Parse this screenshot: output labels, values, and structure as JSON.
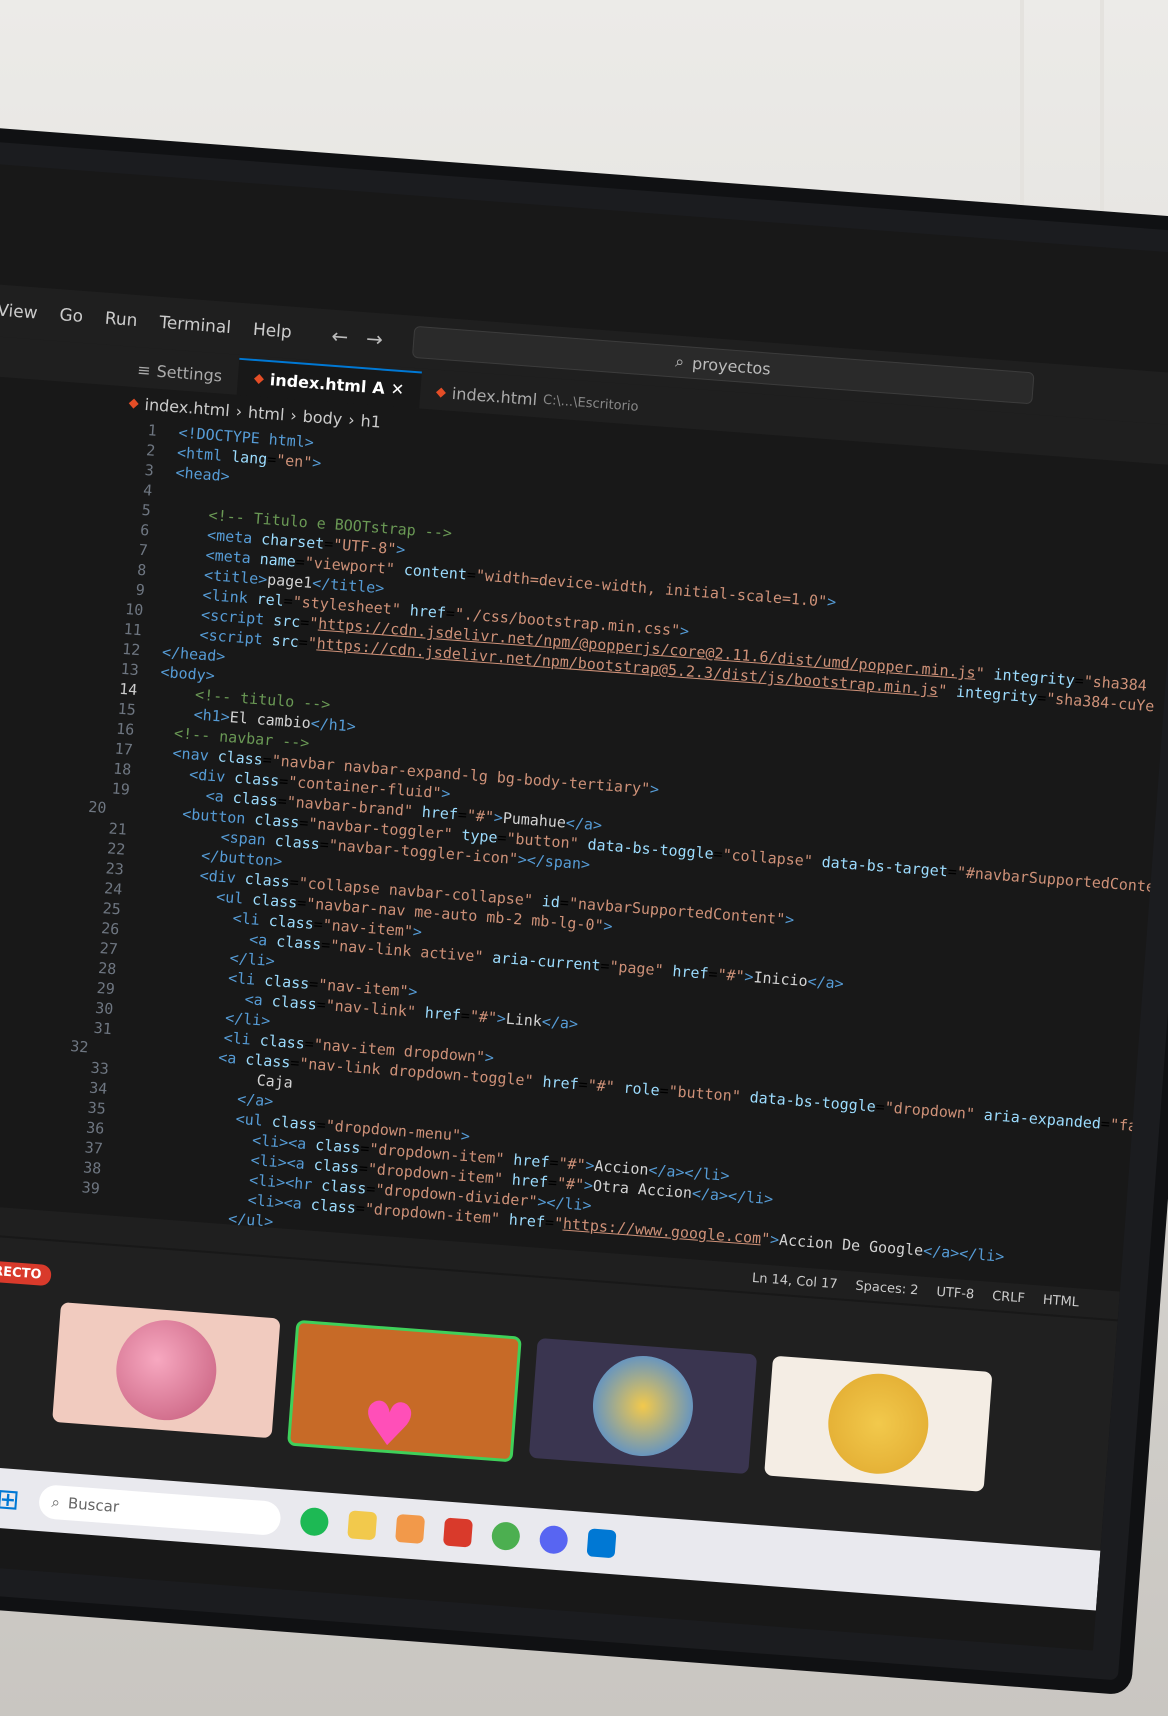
{
  "menu": [
    "View",
    "Go",
    "Run",
    "Terminal",
    "Help"
  ],
  "search": {
    "label": "proyectos"
  },
  "tabs": [
    {
      "label": "Settings"
    },
    {
      "label": "index.html",
      "active": true,
      "modified": "A"
    },
    {
      "label": "index.html",
      "path": "C:\\...\\Escritorio"
    }
  ],
  "breadcrumb": [
    "index.html",
    "html",
    "body",
    "h1"
  ],
  "code": [
    {
      "n": "1",
      "html": "<span class='tag'>&lt;!DOCTYPE html&gt;</span>"
    },
    {
      "n": "2",
      "html": "<span class='tag'>&lt;html</span> <span class='attr'>lang</span>=<span class='str'>\"en\"</span><span class='tag'>&gt;</span>"
    },
    {
      "n": "3",
      "html": "<span class='tag'>&lt;head&gt;</span>"
    },
    {
      "n": "4",
      "html": ""
    },
    {
      "n": "5",
      "html": "    <span class='cmt'>&lt;!-- Titulo e BOOTstrap --&gt;</span>"
    },
    {
      "n": "6",
      "html": "    <span class='tag'>&lt;meta</span> <span class='attr'>charset</span>=<span class='str'>\"UTF-8\"</span><span class='tag'>&gt;</span>"
    },
    {
      "n": "7",
      "html": "    <span class='tag'>&lt;meta</span> <span class='attr'>name</span>=<span class='str'>\"viewport\"</span> <span class='attr'>content</span>=<span class='str'>\"width=device-width, initial-scale=1.0\"</span><span class='tag'>&gt;</span>"
    },
    {
      "n": "8",
      "html": "    <span class='tag'>&lt;title&gt;</span><span class='txt'>page1</span><span class='tag'>&lt;/title&gt;</span>"
    },
    {
      "n": "9",
      "html": "    <span class='tag'>&lt;link</span> <span class='attr'>rel</span>=<span class='str'>\"stylesheet\"</span> <span class='attr'>href</span>=<span class='str'>\"./css/bootstrap.min.css\"</span><span class='tag'>&gt;</span>"
    },
    {
      "n": "10",
      "html": "    <span class='tag'>&lt;script</span> <span class='attr'>src</span>=<span class='str'>\"<span class='url'>https://cdn.jsdelivr.net/npm/@popperjs/core@2.11.6/dist/umd/popper.min.js</span>\"</span> <span class='attr'>integrity</span>=<span class='str'>\"sha384</span>"
    },
    {
      "n": "11",
      "html": "    <span class='tag'>&lt;script</span> <span class='attr'>src</span>=<span class='str'>\"<span class='url'>https://cdn.jsdelivr.net/npm/bootstrap@5.2.3/dist/js/bootstrap.min.js</span>\"</span> <span class='attr'>integrity</span>=<span class='str'>\"sha384-cuYe</span>"
    },
    {
      "n": "12",
      "html": "<span class='tag'>&lt;/head&gt;</span>"
    },
    {
      "n": "13",
      "html": "<span class='tag'>&lt;body&gt;</span>"
    },
    {
      "n": "14",
      "html": "    <span class='cmt'>&lt;!-- titulo --&gt;</span>",
      "cur": true
    },
    {
      "n": "15",
      "html": "    <span class='tag'>&lt;h1&gt;</span><span class='txt'>El cambio</span><span class='tag'>&lt;/h1&gt;</span>"
    },
    {
      "n": "16",
      "html": "  <span class='cmt'>&lt;!-- navbar --&gt;</span>"
    },
    {
      "n": "17",
      "html": "  <span class='tag'>&lt;nav</span> <span class='attr'>class</span>=<span class='str'>\"navbar navbar-expand-lg bg-body-tertiary\"</span><span class='tag'>&gt;</span>"
    },
    {
      "n": "18",
      "html": "    <span class='tag'>&lt;div</span> <span class='attr'>class</span>=<span class='str'>\"container-fluid\"</span><span class='tag'>&gt;</span>"
    },
    {
      "n": "19",
      "html": "      <span class='tag'>&lt;a</span> <span class='attr'>class</span>=<span class='str'>\"navbar-brand\"</span> <span class='attr'>href</span>=<span class='str'>\"#\"</span><span class='tag'>&gt;</span><span class='txt'>Pumahue</span><span class='tag'>&lt;/a&gt;</span>"
    },
    {
      "n": "20",
      "html": "      <span class='tag'>&lt;button</span> <span class='attr'>class</span>=<span class='str'>\"navbar-toggler\"</span> <span class='attr'>type</span>=<span class='str'>\"button\"</span> <span class='attr'>data-bs-toggle</span>=<span class='str'>\"collapse\"</span> <span class='attr'>data-bs-target</span>=<span class='str'>\"#navbarSupportedConte</span>"
    },
    {
      "n": "21",
      "html": "        <span class='tag'>&lt;span</span> <span class='attr'>class</span>=<span class='str'>\"navbar-toggler-icon\"</span><span class='tag'>&gt;&lt;/span&gt;</span>"
    },
    {
      "n": "22",
      "html": "      <span class='tag'>&lt;/button&gt;</span>"
    },
    {
      "n": "23",
      "html": "      <span class='tag'>&lt;div</span> <span class='attr'>class</span>=<span class='str'>\"collapse navbar-collapse\"</span> <span class='attr'>id</span>=<span class='str'>\"navbarSupportedContent\"</span><span class='tag'>&gt;</span>"
    },
    {
      "n": "24",
      "html": "        <span class='tag'>&lt;ul</span> <span class='attr'>class</span>=<span class='str'>\"navbar-nav me-auto mb-2 mb-lg-0\"</span><span class='tag'>&gt;</span>"
    },
    {
      "n": "25",
      "html": "          <span class='tag'>&lt;li</span> <span class='attr'>class</span>=<span class='str'>\"nav-item\"</span><span class='tag'>&gt;</span>"
    },
    {
      "n": "26",
      "html": "            <span class='tag'>&lt;a</span> <span class='attr'>class</span>=<span class='str'>\"nav-link active\"</span> <span class='attr'>aria-current</span>=<span class='str'>\"page\"</span> <span class='attr'>href</span>=<span class='str'>\"#\"</span><span class='tag'>&gt;</span><span class='txt'>Inicio</span><span class='tag'>&lt;/a&gt;</span>"
    },
    {
      "n": "27",
      "html": "          <span class='tag'>&lt;/li&gt;</span>"
    },
    {
      "n": "28",
      "html": "          <span class='tag'>&lt;li</span> <span class='attr'>class</span>=<span class='str'>\"nav-item\"</span><span class='tag'>&gt;</span>"
    },
    {
      "n": "29",
      "html": "            <span class='tag'>&lt;a</span> <span class='attr'>class</span>=<span class='str'>\"nav-link\"</span> <span class='attr'>href</span>=<span class='str'>\"#\"</span><span class='tag'>&gt;</span><span class='txt'>Link</span><span class='tag'>&lt;/a&gt;</span>"
    },
    {
      "n": "30",
      "html": "          <span class='tag'>&lt;/li&gt;</span>"
    },
    {
      "n": "31",
      "html": "          <span class='tag'>&lt;li</span> <span class='attr'>class</span>=<span class='str'>\"nav-item dropdown\"</span><span class='tag'>&gt;</span>"
    },
    {
      "n": "32",
      "html": "            <span class='tag'>&lt;a</span> <span class='attr'>class</span>=<span class='str'>\"nav-link dropdown-toggle\"</span> <span class='attr'>href</span>=<span class='str'>\"#\"</span> <span class='attr'>role</span>=<span class='str'>\"button\"</span> <span class='attr'>data-bs-toggle</span>=<span class='str'>\"dropdown\"</span> <span class='attr'>aria-expanded</span>=<span class='str'>\"false\"</span><span class='tag'>&gt;</span>"
    },
    {
      "n": "33",
      "html": "              <span class='txt'>Caja</span>"
    },
    {
      "n": "34",
      "html": "            <span class='tag'>&lt;/a&gt;</span>"
    },
    {
      "n": "35",
      "html": "            <span class='tag'>&lt;ul</span> <span class='attr'>class</span>=<span class='str'>\"dropdown-menu\"</span><span class='tag'>&gt;</span>"
    },
    {
      "n": "36",
      "html": "              <span class='tag'>&lt;li&gt;&lt;a</span> <span class='attr'>class</span>=<span class='str'>\"dropdown-item\"</span> <span class='attr'>href</span>=<span class='str'>\"#\"</span><span class='tag'>&gt;</span><span class='txt'>Accion</span><span class='tag'>&lt;/a&gt;&lt;/li&gt;</span>"
    },
    {
      "n": "37",
      "html": "              <span class='tag'>&lt;li&gt;&lt;a</span> <span class='attr'>class</span>=<span class='str'>\"dropdown-item\"</span> <span class='attr'>href</span>=<span class='str'>\"#\"</span><span class='tag'>&gt;</span><span class='txt'>Otra Accion</span><span class='tag'>&lt;/a&gt;&lt;/li&gt;</span>"
    },
    {
      "n": "38",
      "html": "              <span class='tag'>&lt;li&gt;&lt;hr</span> <span class='attr'>class</span>=<span class='str'>\"dropdown-divider\"</span><span class='tag'>&gt;&lt;/li&gt;</span>"
    },
    {
      "n": "39",
      "html": "              <span class='tag'>&lt;li&gt;&lt;a</span> <span class='attr'>class</span>=<span class='str'>\"dropdown-item\"</span> <span class='attr'>href</span>=<span class='str'>\"<span class='url'>https://www.google.com</span>\"</span><span class='tag'>&gt;</span><span class='txt'>Accion De Google</span><span class='tag'>&lt;/a&gt;&lt;/li&gt;</span>"
    },
    {
      "n": "",
      "html": "            <span class='tag'>&lt;/ul&gt;</span>"
    }
  ],
  "status": {
    "position": "Ln 14, Col 17",
    "spaces": "Spaces: 2",
    "encoding": "UTF-8",
    "eol": "CRLF",
    "language": "HTML"
  },
  "overlay": {
    "badge": "EN DIRECTO"
  },
  "taskbar": {
    "search_placeholder": "Buscar"
  }
}
